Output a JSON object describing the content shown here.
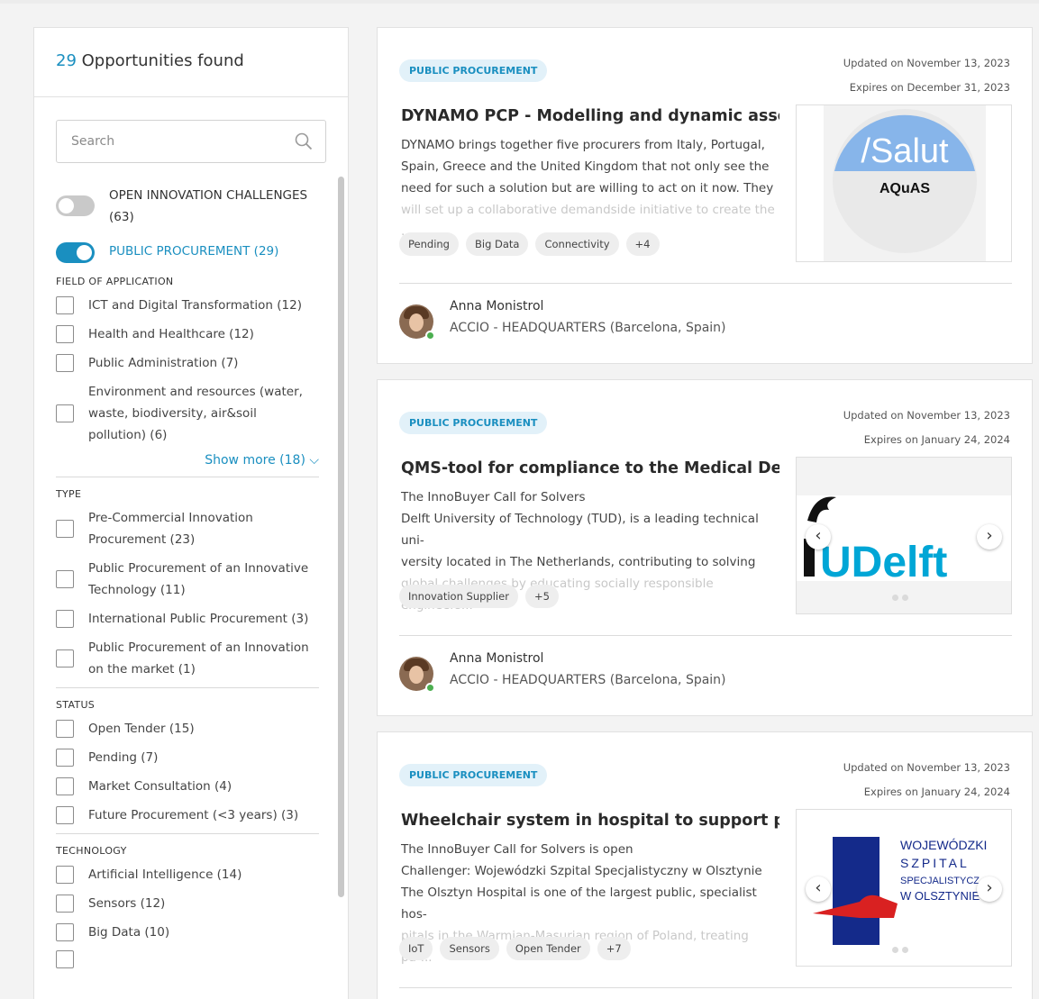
{
  "sidebar": {
    "count": "29",
    "found_label": "Opportunities found",
    "search_placeholder": "Search",
    "toggles": [
      {
        "label": "OPEN INNOVATION CHALLENGES (63)",
        "on": false
      },
      {
        "label": "PUBLIC PROCUREMENT (29)",
        "on": true
      }
    ],
    "groups": {
      "field": {
        "title": "FIELD OF APPLICATION",
        "items": [
          "ICT and Digital Transformation (12)",
          "Health and Healthcare (12)",
          "Public Administration (7)",
          "Environment and resources (water, waste, biodiversity, air&soil pollution) (6)"
        ],
        "show_more": "Show more (18)"
      },
      "type": {
        "title": "TYPE",
        "items": [
          "Pre-Commercial Innovation Procurement (23)",
          "Public Procurement of an Innovative Technology (11)",
          "International Public Procurement (3)",
          "Public Procurement of an Innovation on the market (1)"
        ]
      },
      "status": {
        "title": "STATUS",
        "items": [
          "Open Tender (15)",
          "Pending (7)",
          "Market Consultation (4)",
          "Future Procurement (<3 years) (3)"
        ]
      },
      "technology": {
        "title": "TECHNOLOGY",
        "items": [
          "Artificial Intelligence (14)",
          "Sensors (12)",
          "Big Data (10)"
        ]
      }
    }
  },
  "cards": [
    {
      "badge": "PUBLIC PROCUREMENT",
      "updated": "Updated on November 13, 2023",
      "expires": "Expires on December 31, 2023",
      "title": "DYNAMO PCP - Modelling and dynamic asses...",
      "desc_lines": [
        "DYNAMO brings together five procurers from Italy, Portugal,",
        "Spain, Greece and the United Kingdom that not only see the",
        "need for such a solution but are willing to act on it now. They"
      ],
      "desc_fade": "will set up a collaborative demandside initiative to create the ...",
      "tags": [
        "Pending",
        "Big Data",
        "Connectivity",
        "+4"
      ],
      "author": "Anna Monistrol",
      "org": "ACCIO - HEADQUARTERS (Barcelona, Spain)",
      "logo_text_1": "/Salut",
      "logo_text_2": "AQuAS"
    },
    {
      "badge": "PUBLIC PROCUREMENT",
      "updated": "Updated on November 13, 2023",
      "expires": "Expires on January 24, 2024",
      "title": "QMS-tool for compliance to the Medical Devi...",
      "desc_lines": [
        "The InnoBuyer Call for Solvers",
        "Delft University of Technology (TUD), is a leading technical uni-",
        "versity located in The Netherlands, contributing to solving"
      ],
      "desc_fade": "global challenges by educating socially responsible engineers...",
      "tags": [
        "Innovation Supplier",
        "+5"
      ],
      "author": "Anna Monistrol",
      "org": "ACCIO - HEADQUARTERS (Barcelona, Spain)",
      "logo_text_1": "UDelft"
    },
    {
      "badge": "PUBLIC PROCUREMENT",
      "updated": "Updated on November 13, 2023",
      "expires": "Expires on January 24, 2024",
      "title": "Wheelchair system in hospital to support pat...",
      "desc_lines": [
        "The InnoBuyer Call for Solvers is open",
        "Challenger: Wojewódzki Szpital Specjalistyczny w Olsztynie",
        "The Olsztyn Hospital is one of the largest public, specialist hos-"
      ],
      "desc_fade": "pitals in the Warmian-Masurian region of Poland, treating pa-...",
      "tags": [
        "IoT",
        "Sensors",
        "Open Tender",
        "+7"
      ],
      "logo_lines": [
        "WOJEWÓDZKI",
        "SZPITAL",
        "SPECJALISTYCZ",
        "W OLSZTYNIE"
      ]
    }
  ],
  "colors": {
    "accent": "#1a8fc0",
    "badge_bg": "#e2f1f9",
    "tag_bg": "#eeeeee"
  }
}
